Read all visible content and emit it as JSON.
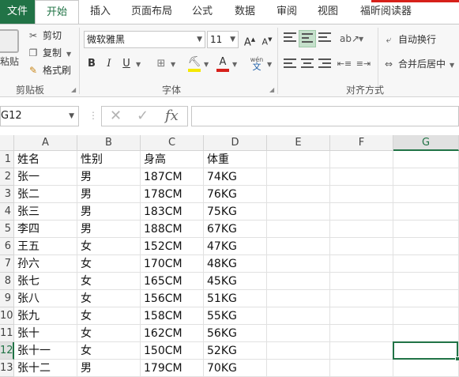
{
  "ribbon_tabs": {
    "file": "文件",
    "home": "开始",
    "insert": "插入",
    "page_layout": "页面布局",
    "formulas": "公式",
    "data": "数据",
    "review": "审阅",
    "view": "视图",
    "foxit": "福昕阅读器"
  },
  "clipboard": {
    "paste": "粘贴",
    "cut": "剪切",
    "copy": "复制",
    "format_painter": "格式刷",
    "group_label": "剪贴板"
  },
  "font": {
    "font_name": "微软雅黑",
    "font_size": "11",
    "grow": "A",
    "shrink": "A",
    "bold": "B",
    "italic": "I",
    "underline": "U",
    "phonetic_top": "wén",
    "phonetic_bottom": "文",
    "group_label": "字体"
  },
  "alignment": {
    "wrap_text": "自动换行",
    "merge_center": "合并后居中",
    "group_label": "对齐方式"
  },
  "formula_bar": {
    "name_box": "G12",
    "cancel": "✕",
    "enter": "✓",
    "fx": "fx",
    "content": ""
  },
  "sheet": {
    "columns": [
      "A",
      "B",
      "C",
      "D",
      "E",
      "F",
      "G"
    ],
    "row_numbers": [
      "1",
      "2",
      "3",
      "4",
      "5",
      "6",
      "7",
      "8",
      "9",
      "10",
      "11",
      "12",
      "13"
    ],
    "rows": [
      [
        "姓名",
        "性别",
        "身高",
        "体重"
      ],
      [
        "张一",
        "男",
        "187CM",
        "74KG"
      ],
      [
        "张二",
        "男",
        "178CM",
        "76KG"
      ],
      [
        "张三",
        "男",
        "183CM",
        "75KG"
      ],
      [
        "李四",
        "男",
        "188CM",
        "67KG"
      ],
      [
        "王五",
        "女",
        "152CM",
        "47KG"
      ],
      [
        "孙六",
        "女",
        "170CM",
        "48KG"
      ],
      [
        "张七",
        "女",
        "165CM",
        "45KG"
      ],
      [
        "张八",
        "女",
        "156CM",
        "51KG"
      ],
      [
        "张九",
        "女",
        "158CM",
        "55KG"
      ],
      [
        "张十",
        "女",
        "162CM",
        "56KG"
      ],
      [
        "张十一",
        "女",
        "150CM",
        "52KG"
      ],
      [
        "张十二",
        "男",
        "179CM",
        "70KG"
      ]
    ],
    "selected_cell": "G12"
  },
  "colors": {
    "excel_green": "#217346",
    "font_color_bar": "#d6201a",
    "highlight_bar": "#f5e800"
  }
}
